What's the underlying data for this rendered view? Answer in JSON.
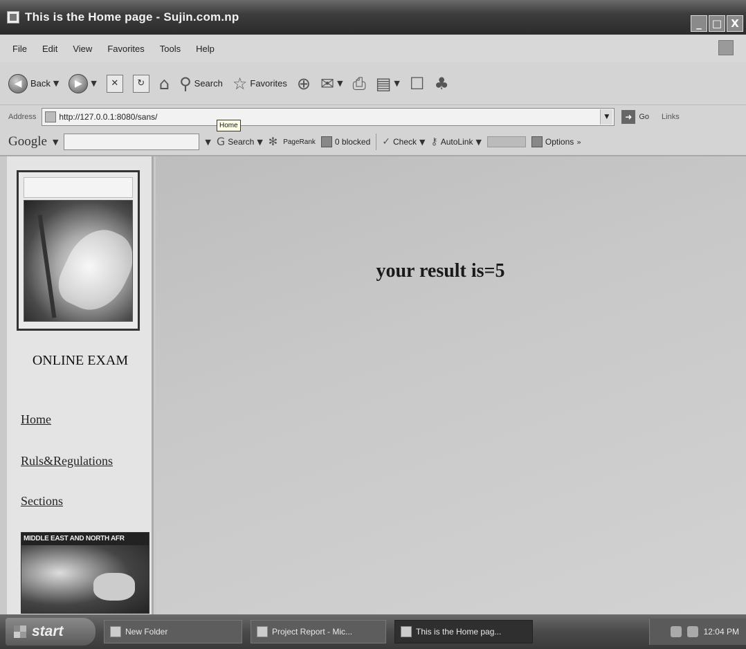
{
  "window": {
    "title": "This is the Home page - Sujin.com.np",
    "buttons": [
      "_",
      "□",
      "X"
    ]
  },
  "menu": [
    "File",
    "Edit",
    "View",
    "Favorites",
    "Tools",
    "Help"
  ],
  "toolbar": {
    "back": "Back",
    "search": "Search",
    "favorites": "Favorites"
  },
  "address": {
    "label": "Address",
    "url": "http://127.0.0.1:8080/sans/",
    "go": "Go",
    "links": "Links",
    "tooltip": "Home"
  },
  "google": {
    "logo": "Google",
    "search": "Search",
    "pagerank": "PageRank",
    "blocked": "0 blocked",
    "check": "Check",
    "autolink": "AutoLink",
    "options": "Options"
  },
  "sidebar": {
    "heading": "ONLINE EXAM",
    "links": [
      "Home",
      "Ruls&Regulations",
      "Sections"
    ],
    "map_caption": "MIDDLE EAST AND NORTH AFR"
  },
  "main": {
    "result": "your result is=5"
  },
  "taskbar": {
    "start": "start",
    "tasks": [
      "New Folder",
      "Project Report - Mic...",
      "This is the Home pag..."
    ],
    "clock": "12:04 PM"
  }
}
